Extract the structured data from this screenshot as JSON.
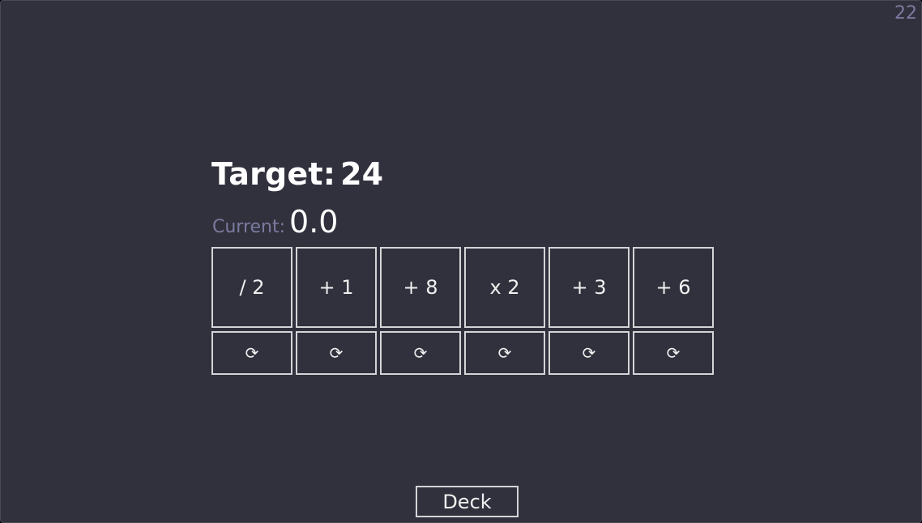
{
  "counter": "22",
  "target": {
    "label": "Target:",
    "value": "24"
  },
  "current": {
    "label": "Current:",
    "value": "0.0"
  },
  "cards": [
    {
      "label": "/ 2",
      "reroll_icon": "⟳"
    },
    {
      "label": "+ 1",
      "reroll_icon": "⟳"
    },
    {
      "label": "+ 8",
      "reroll_icon": "⟳"
    },
    {
      "label": "x 2",
      "reroll_icon": "⟳"
    },
    {
      "label": "+ 3",
      "reroll_icon": "⟳"
    },
    {
      "label": "+ 6",
      "reroll_icon": "⟳"
    }
  ],
  "deck_button": "Deck",
  "colors": {
    "background": "#31313d",
    "muted_text": "#7b7aa0",
    "border": "#d4d4d8"
  }
}
